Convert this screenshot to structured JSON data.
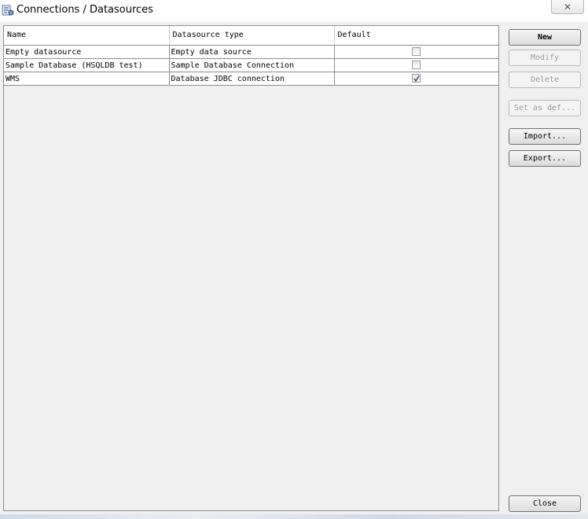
{
  "window": {
    "title": "Connections / Datasources",
    "close_glyph": "✕"
  },
  "table": {
    "headers": [
      "Name",
      "Datasource type",
      "Default"
    ],
    "rows": [
      {
        "name": "Empty datasource",
        "type": "Empty data source",
        "default": false
      },
      {
        "name": "Sample Database (HSQLDB test)",
        "type": "Sample Database Connection",
        "default": false
      },
      {
        "name": "WMS",
        "type": "Database JDBC connection",
        "default": true
      }
    ]
  },
  "buttons": {
    "new": "New",
    "modify": "Modify",
    "delete": "Delete",
    "set_default": "Set as def...",
    "import": "Import...",
    "export": "Export...",
    "close": "Close"
  },
  "icons": {
    "app": "datasource-app-icon",
    "close": "close-icon",
    "check": "check-icon"
  }
}
